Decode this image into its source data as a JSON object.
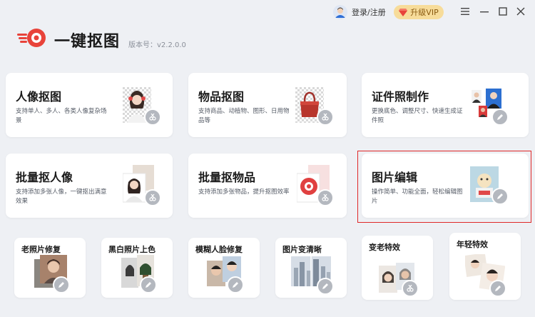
{
  "header": {
    "app_title": "一键抠图",
    "version": "版本号：v2.2.0.0",
    "login_label": "登录/注册",
    "vip_label": "升级VIP",
    "icons": [
      "user-avatar-icon",
      "diamond-icon",
      "menu-icon",
      "minimize-icon",
      "maximize-icon",
      "close-icon"
    ]
  },
  "colors": {
    "brand_red": "#e8433a",
    "vip_gold": "#f7dc9a",
    "selection_red": "#e02828"
  },
  "large_cards": [
    {
      "title": "人像抠图",
      "desc": "支持单人、多人、各类人像复杂场景"
    },
    {
      "title": "物品抠图",
      "desc": "支持商品、动植物、图形、日用物品等"
    },
    {
      "title": "证件照制作",
      "desc": "更换底色、调整尺寸、快速生成证件照"
    },
    {
      "title": "批量抠人像",
      "desc": "支持添加多张人像，一键抠出满意效果"
    },
    {
      "title": "批量抠物品",
      "desc": "支持添加多张物品，提升抠图效率"
    },
    {
      "title": "图片编辑",
      "desc": "操作简单、功能全面，轻松编辑图片"
    }
  ],
  "small_cards": [
    {
      "title": "老照片修复"
    },
    {
      "title": "黑白照片上色"
    },
    {
      "title": "模糊人脸修复"
    },
    {
      "title": "图片变清晰"
    },
    {
      "title": "变老特效"
    },
    {
      "title": "年轻特效"
    }
  ]
}
